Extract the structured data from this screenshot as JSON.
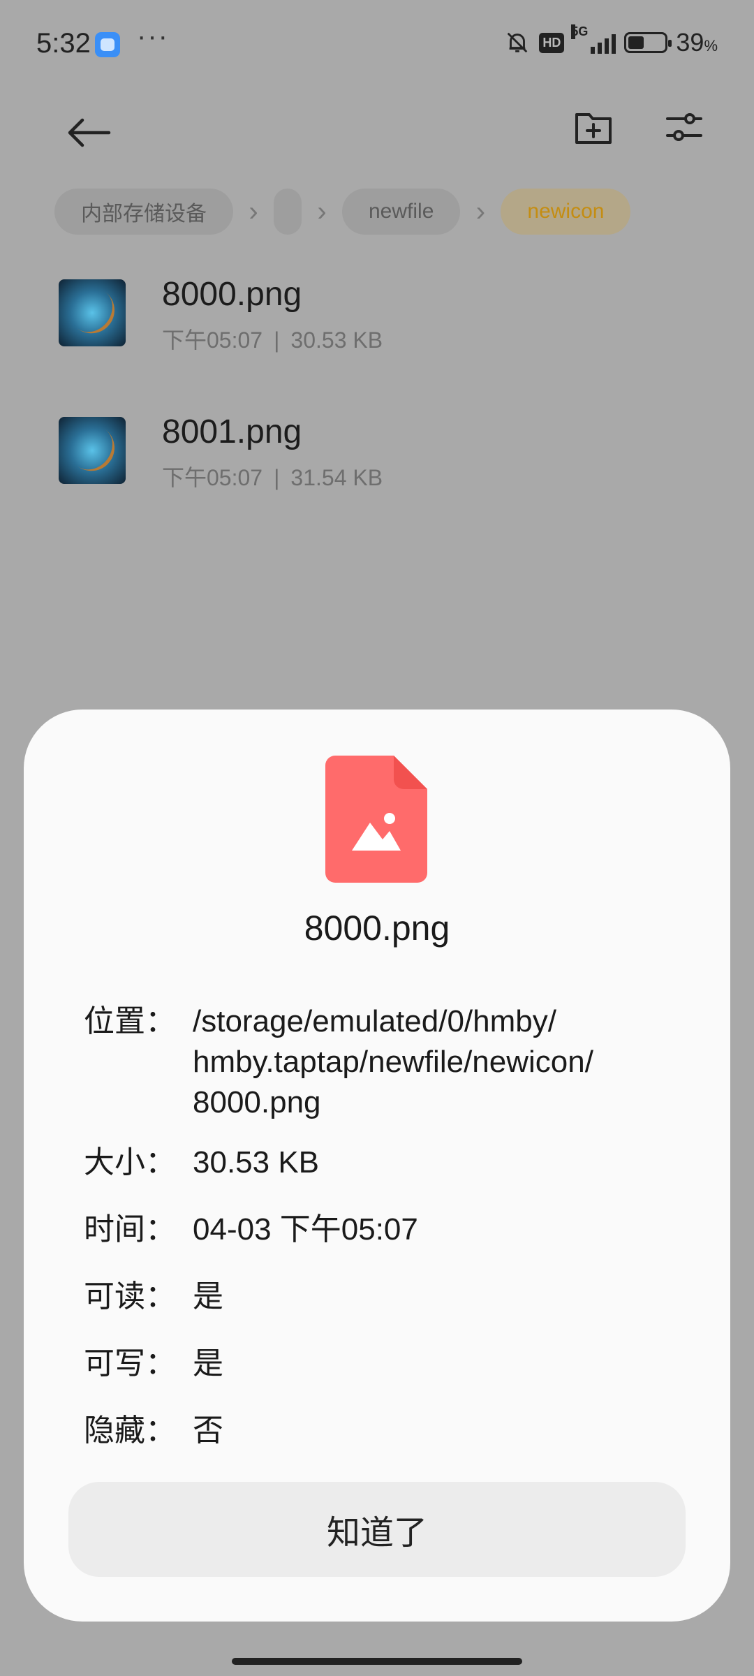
{
  "status_bar": {
    "time": "5:32",
    "overflow": "···",
    "hd": "HD",
    "network": "5G",
    "battery_percent": "39",
    "battery_unit": "%"
  },
  "toolbar": {
    "back_icon": "arrow-left-icon",
    "new_folder_icon": "folder-add-icon",
    "filter_icon": "sliders-icon"
  },
  "breadcrumb": {
    "items": [
      "内部存储设备",
      "",
      "newfile",
      "newicon"
    ]
  },
  "files": [
    {
      "name": "8000.png",
      "time": "下午05:07",
      "size": "30.53 KB"
    },
    {
      "name": "8001.png",
      "time": "下午05:07",
      "size": "31.54 KB"
    }
  ],
  "meta_separator": "|",
  "details": {
    "icon": "image-file-icon",
    "icon_color": "#ff6b6b",
    "title": "8000.png",
    "properties": [
      {
        "label": "位置：",
        "value": "/storage/emulated/0/hmby/\nhmby.taptap/newfile/newicon/\n8000.png"
      },
      {
        "label": "大小：",
        "value": "30.53 KB"
      },
      {
        "label": "时间：",
        "value": "04-03 下午05:07"
      },
      {
        "label": "可读：",
        "value": "是"
      },
      {
        "label": "可写：",
        "value": "是"
      },
      {
        "label": "隐藏：",
        "value": "否"
      }
    ],
    "ok_label": "知道了"
  },
  "colors": {
    "dim_background": "#a9a9a9",
    "sheet_background": "#fafafa",
    "active_crumb_text": "#c48d12"
  }
}
